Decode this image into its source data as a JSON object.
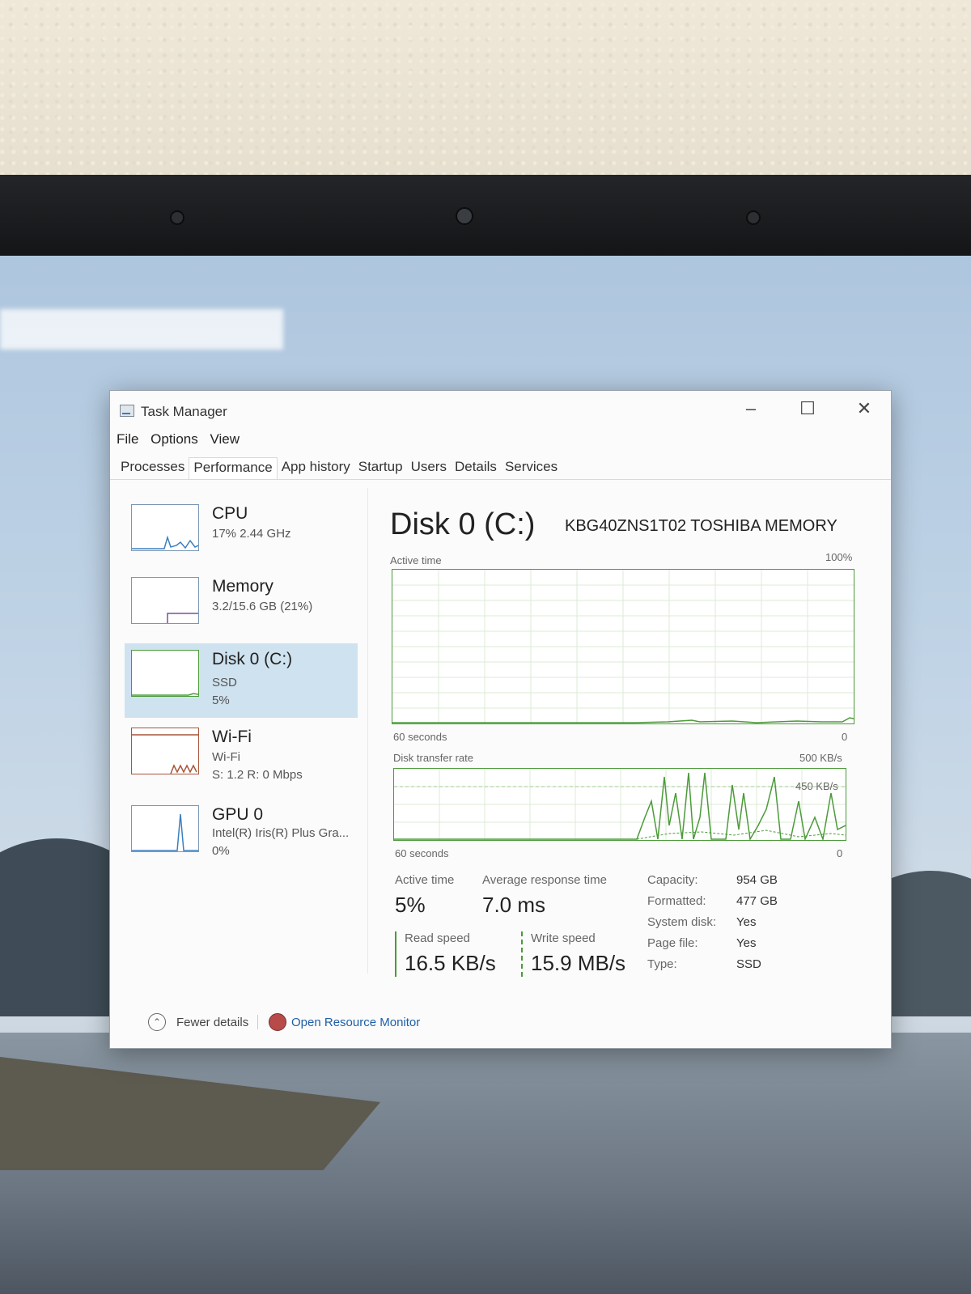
{
  "window": {
    "title": "Task Manager"
  },
  "menu": [
    "File",
    "Options",
    "View"
  ],
  "tabs": [
    "Processes",
    "Performance",
    "App history",
    "Startup",
    "Users",
    "Details",
    "Services"
  ],
  "sidebar": [
    {
      "name": "CPU",
      "sub1": "17% 2.44 GHz",
      "sub2": ""
    },
    {
      "name": "Memory",
      "sub1": "3.2/15.6 GB (21%)",
      "sub2": ""
    },
    {
      "name": "Disk 0 (C:)",
      "sub1": "SSD",
      "sub2": "5%"
    },
    {
      "name": "Wi-Fi",
      "sub1": "Wi-Fi",
      "sub2": "S: 1.2 R: 0 Mbps"
    },
    {
      "name": "GPU 0",
      "sub1": "Intel(R) Iris(R) Plus Gra...",
      "sub2": "0%"
    }
  ],
  "main": {
    "title": "Disk 0 (C:)",
    "model": "KBG40ZNS1T02 TOSHIBA MEMORY",
    "active_graph": {
      "label": "Active time",
      "max": "100%",
      "time": "60 seconds",
      "min": "0"
    },
    "transfer_graph": {
      "label": "Disk transfer rate",
      "max": "500 KB/s",
      "line": "450 KB/s",
      "time": "60 seconds",
      "min": "0"
    }
  },
  "stats": {
    "active_time_label": "Active time",
    "active_time": "5%",
    "response_label": "Average response time",
    "response": "7.0 ms",
    "read_label": "Read speed",
    "read": "16.5 KB/s",
    "write_label": "Write speed",
    "write": "15.9 MB/s"
  },
  "props": [
    {
      "k": "Capacity:",
      "v": "954 GB"
    },
    {
      "k": "Formatted:",
      "v": "477 GB"
    },
    {
      "k": "System disk:",
      "v": "Yes"
    },
    {
      "k": "Page file:",
      "v": "Yes"
    },
    {
      "k": "Type:",
      "v": "SSD"
    }
  ],
  "footer": {
    "fewer": "Fewer details",
    "resource": "Open Resource Monitor"
  },
  "colors": {
    "accent": "#4c9a3a",
    "selected": "#cfe2ef",
    "link": "#1f5fa8"
  }
}
